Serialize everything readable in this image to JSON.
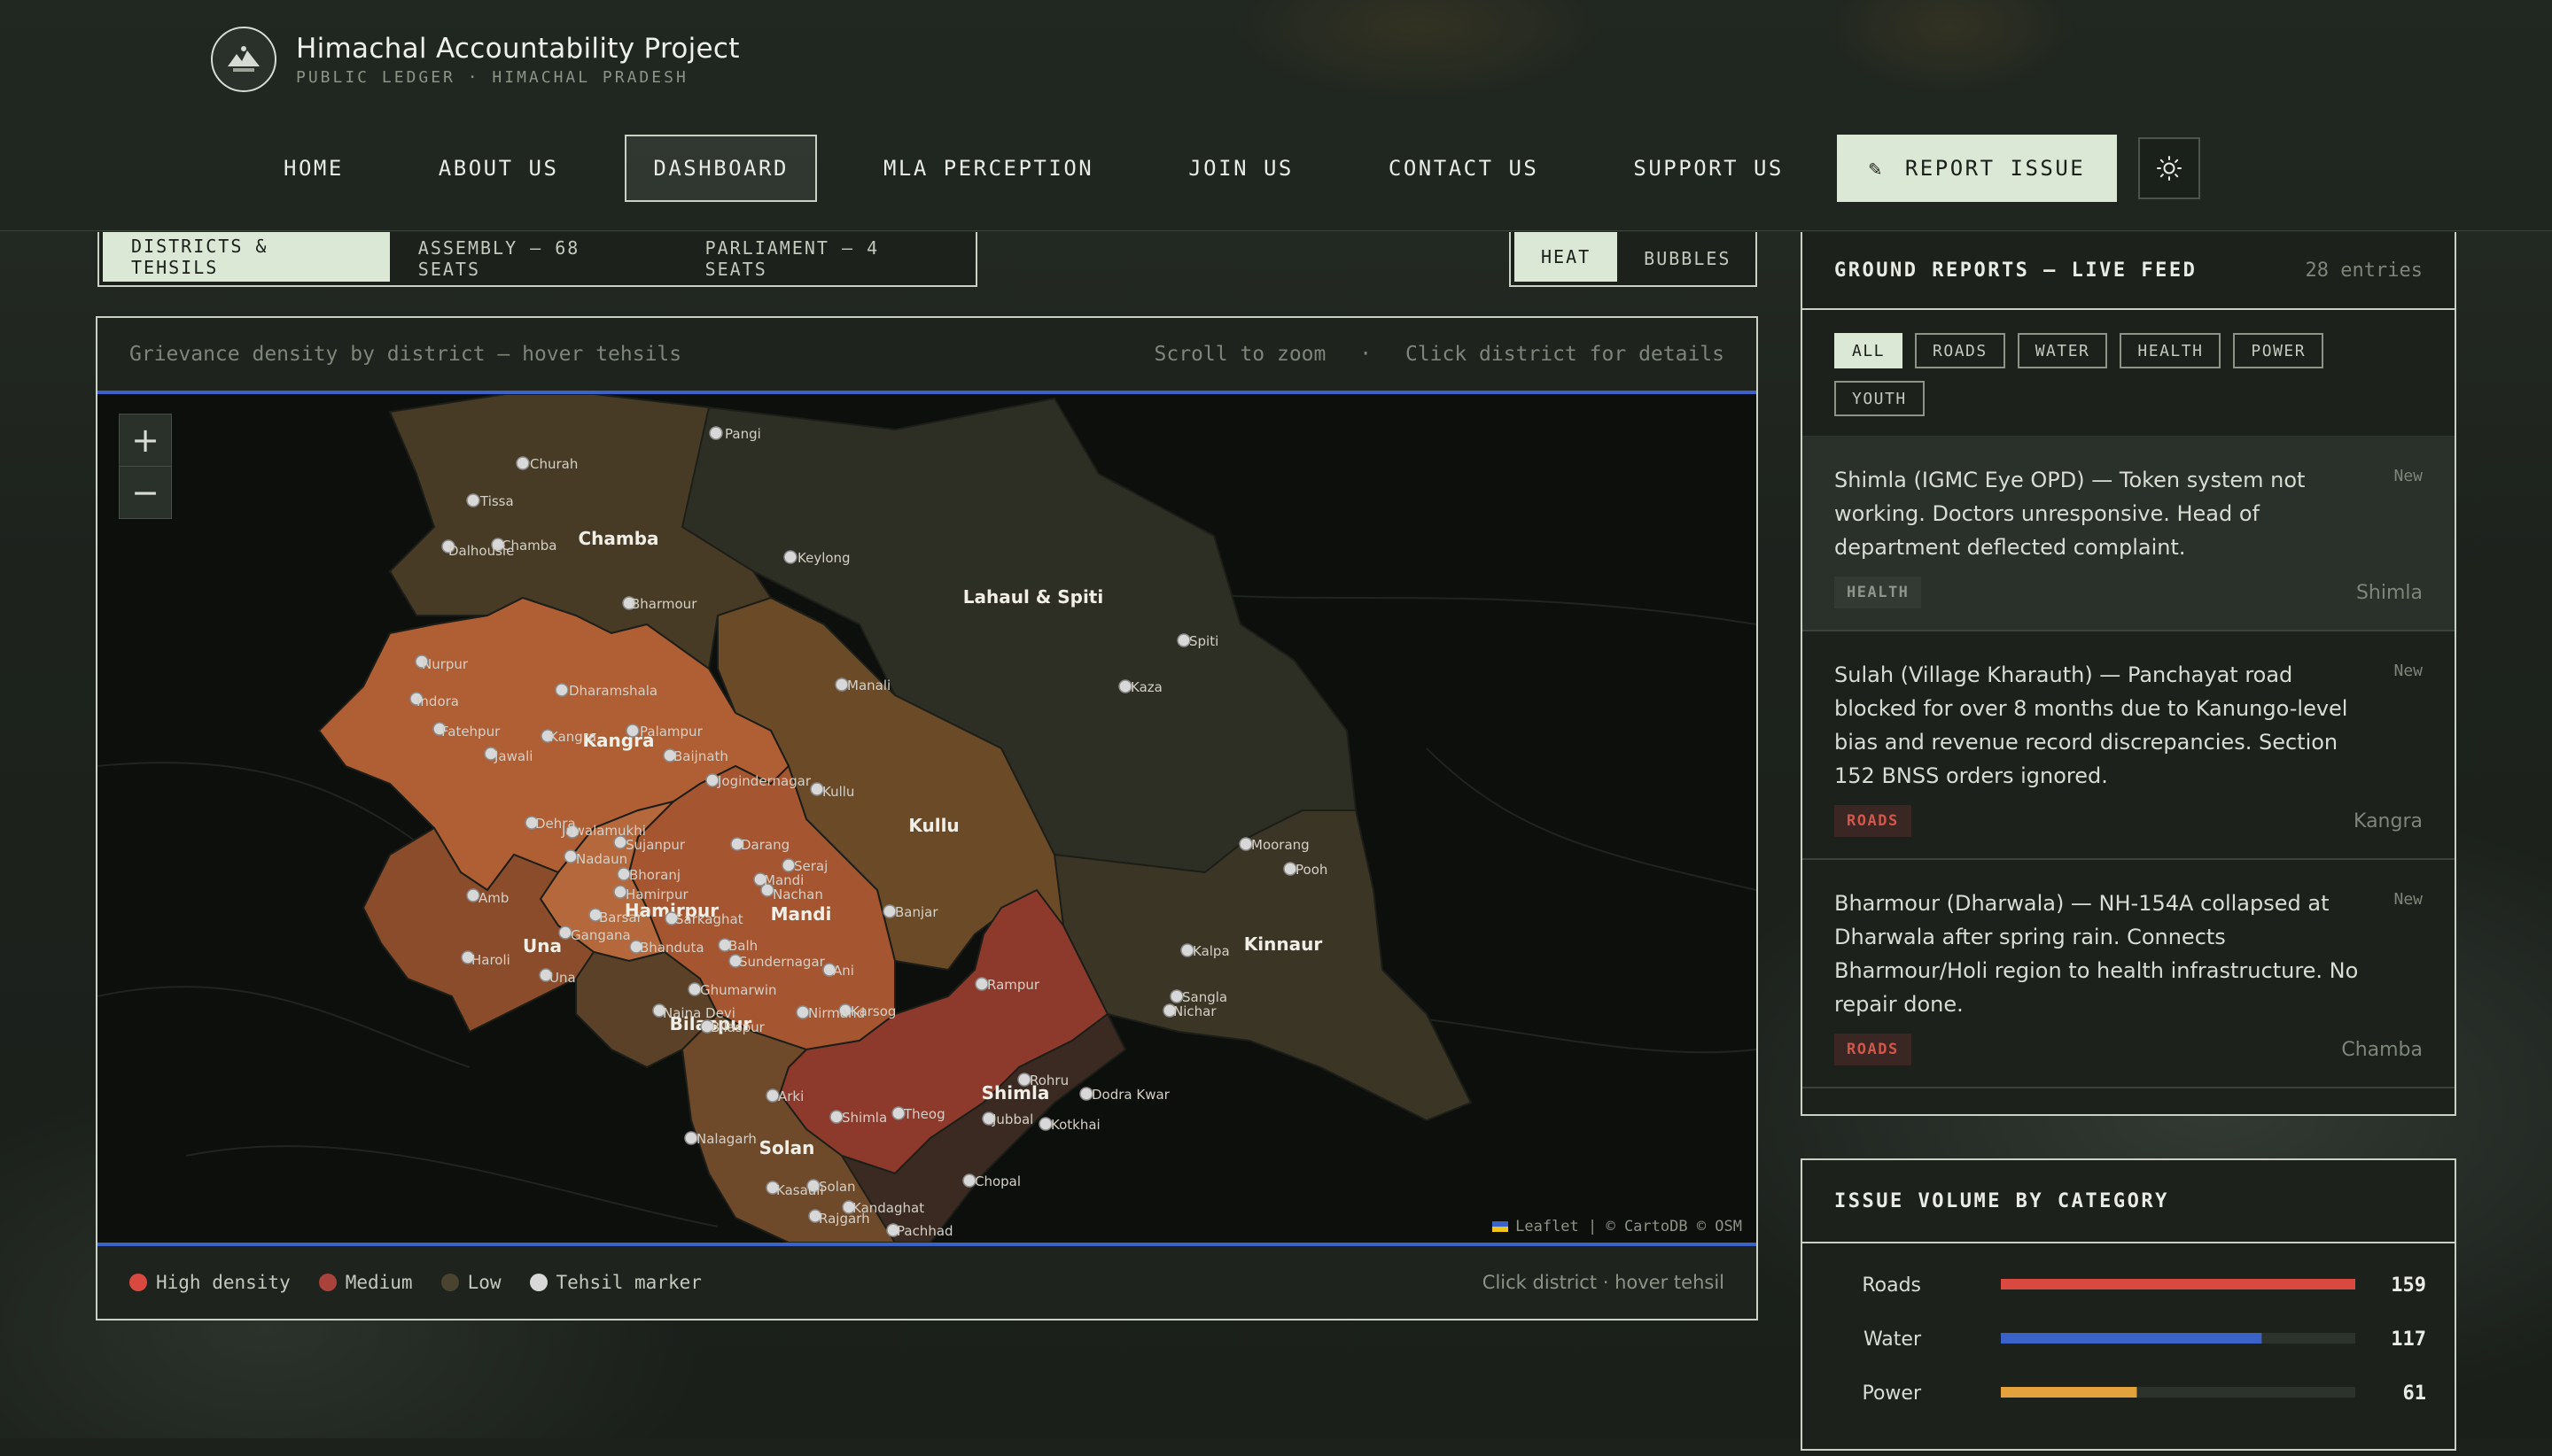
{
  "brand": {
    "title": "Himachal Accountability Project",
    "subtitle": "PUBLIC LEDGER · HIMACHAL PRADESH"
  },
  "nav": {
    "items": [
      {
        "label": "HOME",
        "active": false
      },
      {
        "label": "ABOUT US",
        "active": false
      },
      {
        "label": "DASHBOARD",
        "active": true
      },
      {
        "label": "MLA PERCEPTION",
        "active": false
      },
      {
        "label": "JOIN US",
        "active": false
      },
      {
        "label": "CONTACT US",
        "active": false
      },
      {
        "label": "SUPPORT US",
        "active": false
      }
    ],
    "cta_icon": "✎",
    "cta_label": "REPORT ISSUE",
    "theme_icon": "sun-icon"
  },
  "map_tabs": [
    "DISTRICTS & TEHSILS",
    "ASSEMBLY — 68 SEATS",
    "PARLIAMENT — 4 SEATS"
  ],
  "mode_tabs": [
    "HEAT",
    "BUBBLES"
  ],
  "map": {
    "caption": "Grievance density by district — hover tehsils",
    "hint_zoom": "Scroll to zoom",
    "hint_sep": "·",
    "hint_click": "Click district for details",
    "zoom_in": "+",
    "zoom_out": "−",
    "attribution": "Leaflet | © CartoDB © OSM",
    "districts": [
      "Chamba",
      "Lahaul & Spiti",
      "Kangra",
      "Kullu",
      "Hamirpur",
      "Mandi",
      "Una",
      "Kinnaur",
      "Bilaspur",
      "Shimla",
      "Solan"
    ],
    "tehsils": [
      "Pangi",
      "Churah",
      "Tissa",
      "Dalhousie",
      "Chamba",
      "Keylong",
      "Bharmour",
      "Spiti",
      "Nurpur",
      "Indora",
      "Dharamshala",
      "Manali",
      "Kaza",
      "Fatehpur",
      "Kangra",
      "Palampur",
      "Jawali",
      "Baijnath",
      "Jogindernagar",
      "Kullu",
      "Dehra",
      "Jawalamukhi",
      "Sujanpur",
      "Nadaun",
      "Darang",
      "Seraj",
      "Bhoranj",
      "Mandi",
      "Nachan",
      "Hamirpur",
      "Amb",
      "Barsar",
      "Sarkaghat",
      "Gangana",
      "Banjar",
      "Bhanduta",
      "Balh",
      "Sundernagar",
      "Ani",
      "Haroli",
      "Una",
      "Ghumarwin",
      "Rampur",
      "Naina Devi",
      "Bilaspur",
      "Karsog",
      "Nirmand",
      "Moorang",
      "Pooh",
      "Kalpa",
      "Sangla",
      "Nichar",
      "Rohru",
      "Arki",
      "Shimla",
      "Theog",
      "Jubbal",
      "Chopal",
      "Dodra Kwar",
      "Kotkhai",
      "Nalagarh",
      "Kasauli",
      "Solan",
      "Rajgarh",
      "Kandaghat",
      "Pachhad"
    ]
  },
  "legend": {
    "items": [
      {
        "label": "High density",
        "color": "#d9493f"
      },
      {
        "label": "Medium",
        "color": "#a8423a"
      },
      {
        "label": "Low",
        "color": "#4a4330"
      },
      {
        "label": "Tehsil marker",
        "color": "#d8d8d8"
      }
    ],
    "hint": "Click district · hover tehsil"
  },
  "feed": {
    "title": "GROUND REPORTS — LIVE FEED",
    "count": "28 entries",
    "filters": [
      "ALL",
      "ROADS",
      "WATER",
      "HEALTH",
      "POWER",
      "YOUTH"
    ],
    "reports": [
      {
        "text": "Shimla (IGMC Eye OPD) — Token system not working. Doctors unresponsive. Head of department deflected complaint.",
        "status": "New",
        "tag": "HEALTH",
        "tag_type": "health",
        "location": "Shimla"
      },
      {
        "text": "Sulah (Village Kharauth) — Panchayat road blocked for over 8 months due to Kanungo-level bias and revenue record discrepancies. Section 152 BNSS orders ignored.",
        "status": "New",
        "tag": "ROADS",
        "tag_type": "roads",
        "location": "Kangra"
      },
      {
        "text": "Bharmour (Dharwala) — NH-154A collapsed at Dharwala after spring rain. Connects Bharmour/Holi region to health infrastructure. No repair done.",
        "status": "New",
        "tag": "ROADS",
        "tag_type": "roads",
        "location": "Chamba"
      }
    ]
  },
  "chart_data": {
    "type": "bar",
    "title": "ISSUE VOLUME BY CATEGORY",
    "orientation": "horizontal",
    "categories": [
      "Roads",
      "Water",
      "Power"
    ],
    "values": [
      159,
      117,
      61
    ],
    "colors": [
      "#d9493f",
      "#3a62c8",
      "#e3a23b"
    ],
    "xlim": [
      0,
      159
    ]
  }
}
